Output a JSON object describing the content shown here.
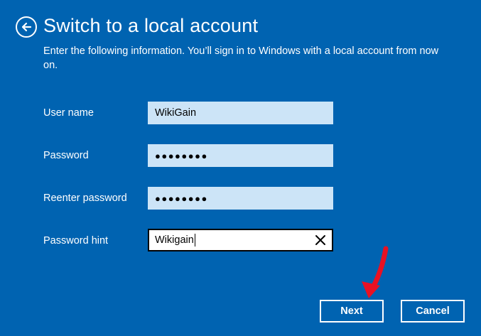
{
  "header": {
    "back_icon": "back-arrow-icon",
    "title": "Switch to a local account"
  },
  "description": "Enter the following information. You’ll sign in to Windows with a local account from now on.",
  "form": {
    "user_name": {
      "label": "User name",
      "value": "WikiGain"
    },
    "password": {
      "label": "Password",
      "value": "●●●●●●●●"
    },
    "reenter_password": {
      "label": "Reenter password",
      "value": "●●●●●●●●"
    },
    "password_hint": {
      "label": "Password hint",
      "value": "Wikigain",
      "clear_icon": "close-icon"
    }
  },
  "buttons": {
    "next_label": "Next",
    "cancel_label": "Cancel"
  },
  "colors": {
    "background": "#0063b1",
    "input_bg": "#cce4f7",
    "annotation_arrow": "#e81123"
  }
}
